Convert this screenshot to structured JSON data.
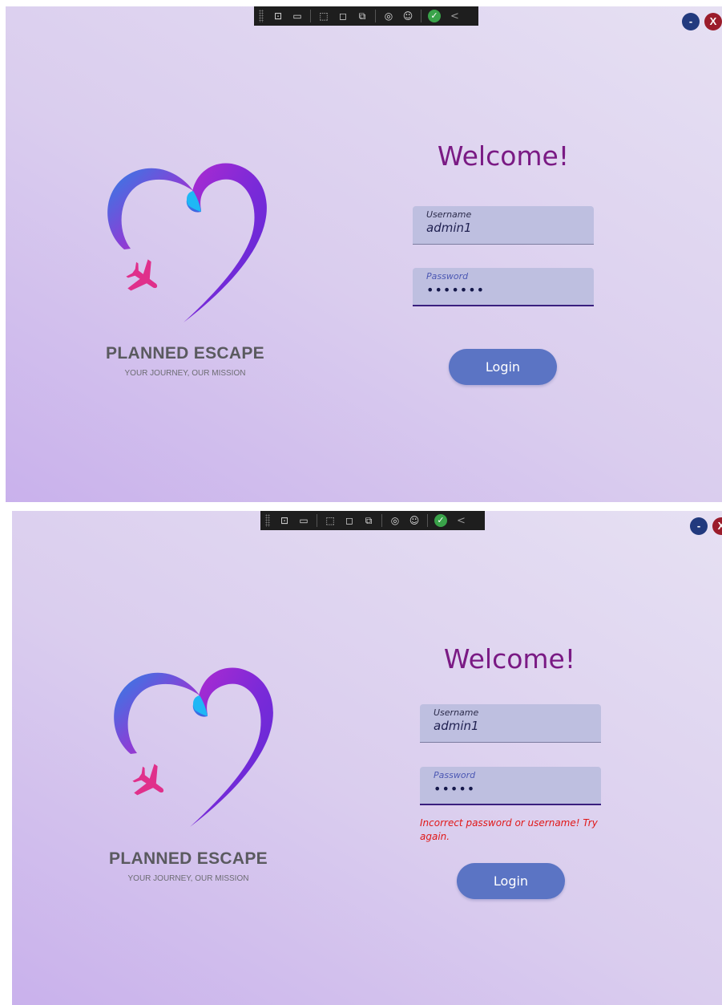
{
  "debug_toolbar": {
    "glyphs": [
      "⊡",
      "▭",
      "⬚",
      "◻",
      "⧉",
      "◎",
      "☺"
    ],
    "check": "✓",
    "collapse": "<",
    "icon_names": [
      "live-visual-tree-icon",
      "video-icon",
      "select-element-icon",
      "display-layout-adorners-icon",
      "track-focus-icon",
      "binding-failures-icon",
      "accessibility-icon",
      "hot-reload-ok-icon",
      "collapse-toolbar-icon"
    ]
  },
  "window": {
    "minimize_label": "-",
    "close_label": "X"
  },
  "brand": {
    "title": "PLANNED ESCAPE",
    "tagline": "YOUR JOURNEY, OUR MISSION"
  },
  "colors": {
    "accent": "#7a1a84",
    "button": "#5b74c4",
    "error": "#e01818",
    "field_bg": "#bebfe0"
  },
  "screens": [
    {
      "welcome": "Welcome!",
      "username_label": "Username",
      "username_value": "admin1",
      "password_label": "Password",
      "password_masked": "•••••••",
      "error": "",
      "login_label": "Login"
    },
    {
      "welcome": "Welcome!",
      "username_label": "Username",
      "username_value": "admin1",
      "password_label": "Password",
      "password_masked": "•••••",
      "error": "Incorrect password or username! Try again.",
      "login_label": "Login"
    }
  ]
}
